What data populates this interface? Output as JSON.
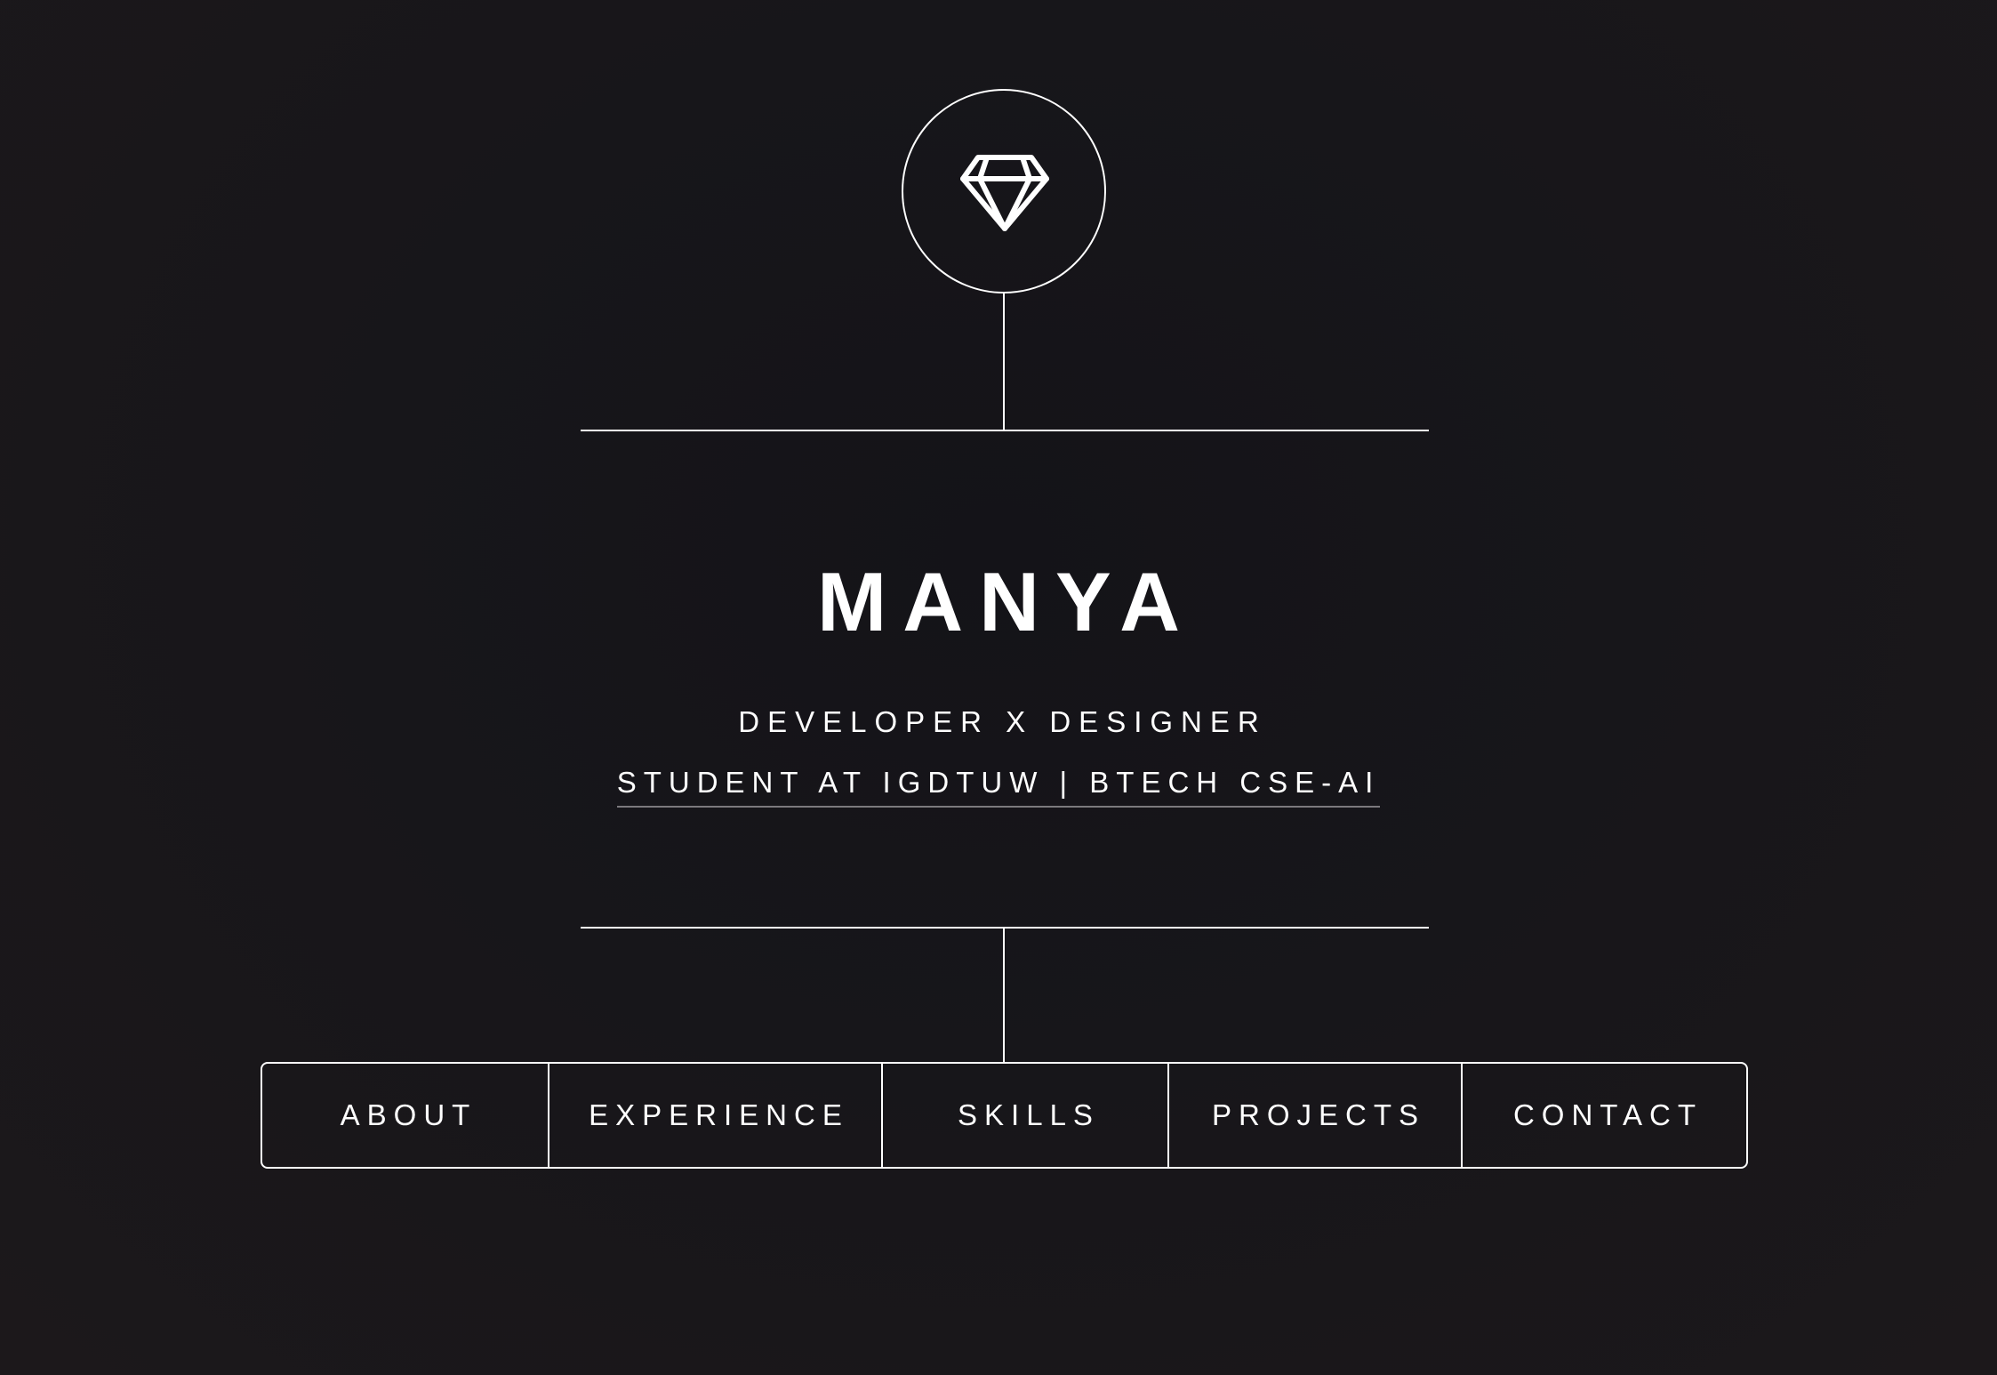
{
  "hero": {
    "logo_icon": "diamond-icon",
    "name": "MANYA",
    "subtitle": "DEVELOPER X DESIGNER",
    "tagline": "STUDENT AT IGDTUW | BTECH CSE-AI"
  },
  "nav": {
    "items": [
      {
        "label": "ABOUT"
      },
      {
        "label": "EXPERIENCE"
      },
      {
        "label": "SKILLS"
      },
      {
        "label": "PROJECTS"
      },
      {
        "label": "CONTACT"
      }
    ]
  },
  "colors": {
    "background": "#17161a",
    "foreground": "#ffffff",
    "underline": "#7b797d"
  }
}
